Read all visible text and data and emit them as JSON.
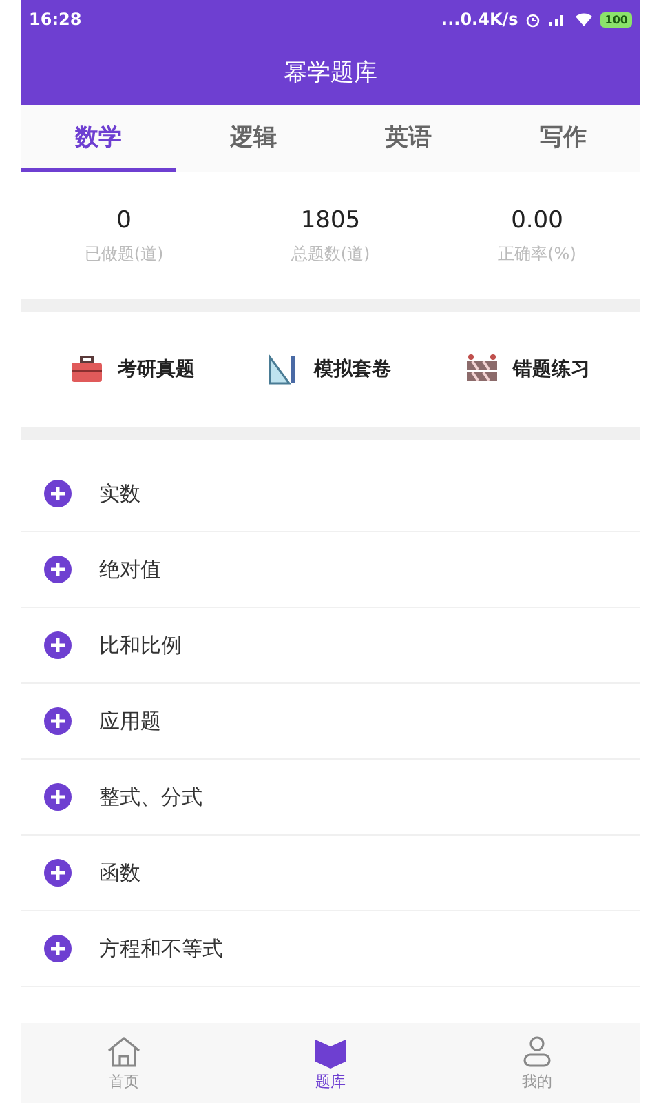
{
  "status_bar": {
    "time": "16:28",
    "network_speed": "...0.4K/s",
    "battery": "100"
  },
  "title": "幂学题库",
  "tabs": [
    {
      "label": "数学",
      "selected": true
    },
    {
      "label": "逻辑",
      "selected": false
    },
    {
      "label": "英语",
      "selected": false
    },
    {
      "label": "写作",
      "selected": false
    }
  ],
  "stats": [
    {
      "value": "0",
      "label": "已做题(道)"
    },
    {
      "value": "1805",
      "label": "总题数(道)"
    },
    {
      "value": "0.00",
      "label": "正确率(%)"
    }
  ],
  "shortcuts": [
    {
      "label": "考研真题",
      "kind": "toolbox"
    },
    {
      "label": "模拟套卷",
      "kind": "ruler"
    },
    {
      "label": "错题练习",
      "kind": "barrier"
    }
  ],
  "topics": [
    {
      "label": "实数"
    },
    {
      "label": "绝对值"
    },
    {
      "label": "比和比例"
    },
    {
      "label": "应用题"
    },
    {
      "label": "整式、分式"
    },
    {
      "label": "函数"
    },
    {
      "label": "方程和不等式"
    }
  ],
  "bottom_nav": [
    {
      "label": "首页",
      "kind": "home",
      "selected": false
    },
    {
      "label": "题库",
      "kind": "book",
      "selected": true
    },
    {
      "label": "我的",
      "kind": "person",
      "selected": false
    }
  ]
}
